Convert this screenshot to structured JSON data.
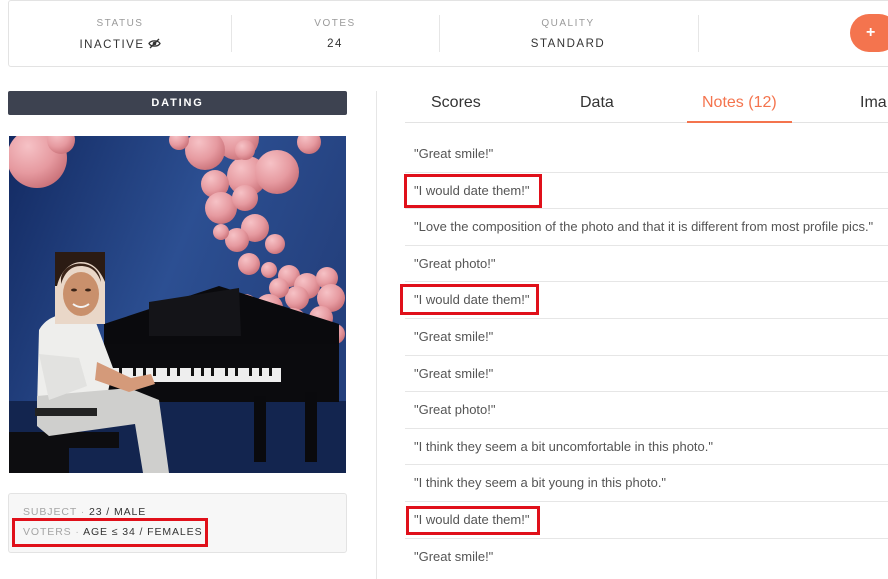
{
  "stats": {
    "status_label": "STATUS",
    "status_value": "INACTIVE",
    "votes_label": "VOTES",
    "votes_value": "24",
    "quality_label": "QUALITY",
    "quality_value": "STANDARD",
    "action_label": "+"
  },
  "category": "DATING",
  "info": {
    "subject_key": "SUBJECT",
    "subject_value": "23 / MALE",
    "voters_key": "VOTERS",
    "voters_value": "AGE ≤ 34 / FEMALES",
    "separator": "·"
  },
  "tabs": [
    {
      "label": "Scores"
    },
    {
      "label": "Data"
    },
    {
      "label": "Notes (12)"
    },
    {
      "label": "Ima"
    }
  ],
  "active_tab_index": 2,
  "notes": [
    "\"Great smile!\"",
    "\"I would date them!\"",
    "\"Love the composition of the photo and that it is different from most profile pics.\"",
    "\"Great photo!\"",
    "\"I would date them!\"",
    "\"Great smile!\"",
    "\"Great smile!\"",
    "\"Great photo!\"",
    "\"I think they seem a bit uncomfortable in this photo.\"",
    "\"I think they seem a bit young in this photo.\"",
    "\"I would date them!\"",
    "\"Great smile!\""
  ],
  "colors": {
    "accent": "#f4744e",
    "category_bar": "#3d4250",
    "highlight": "#e0101a"
  }
}
